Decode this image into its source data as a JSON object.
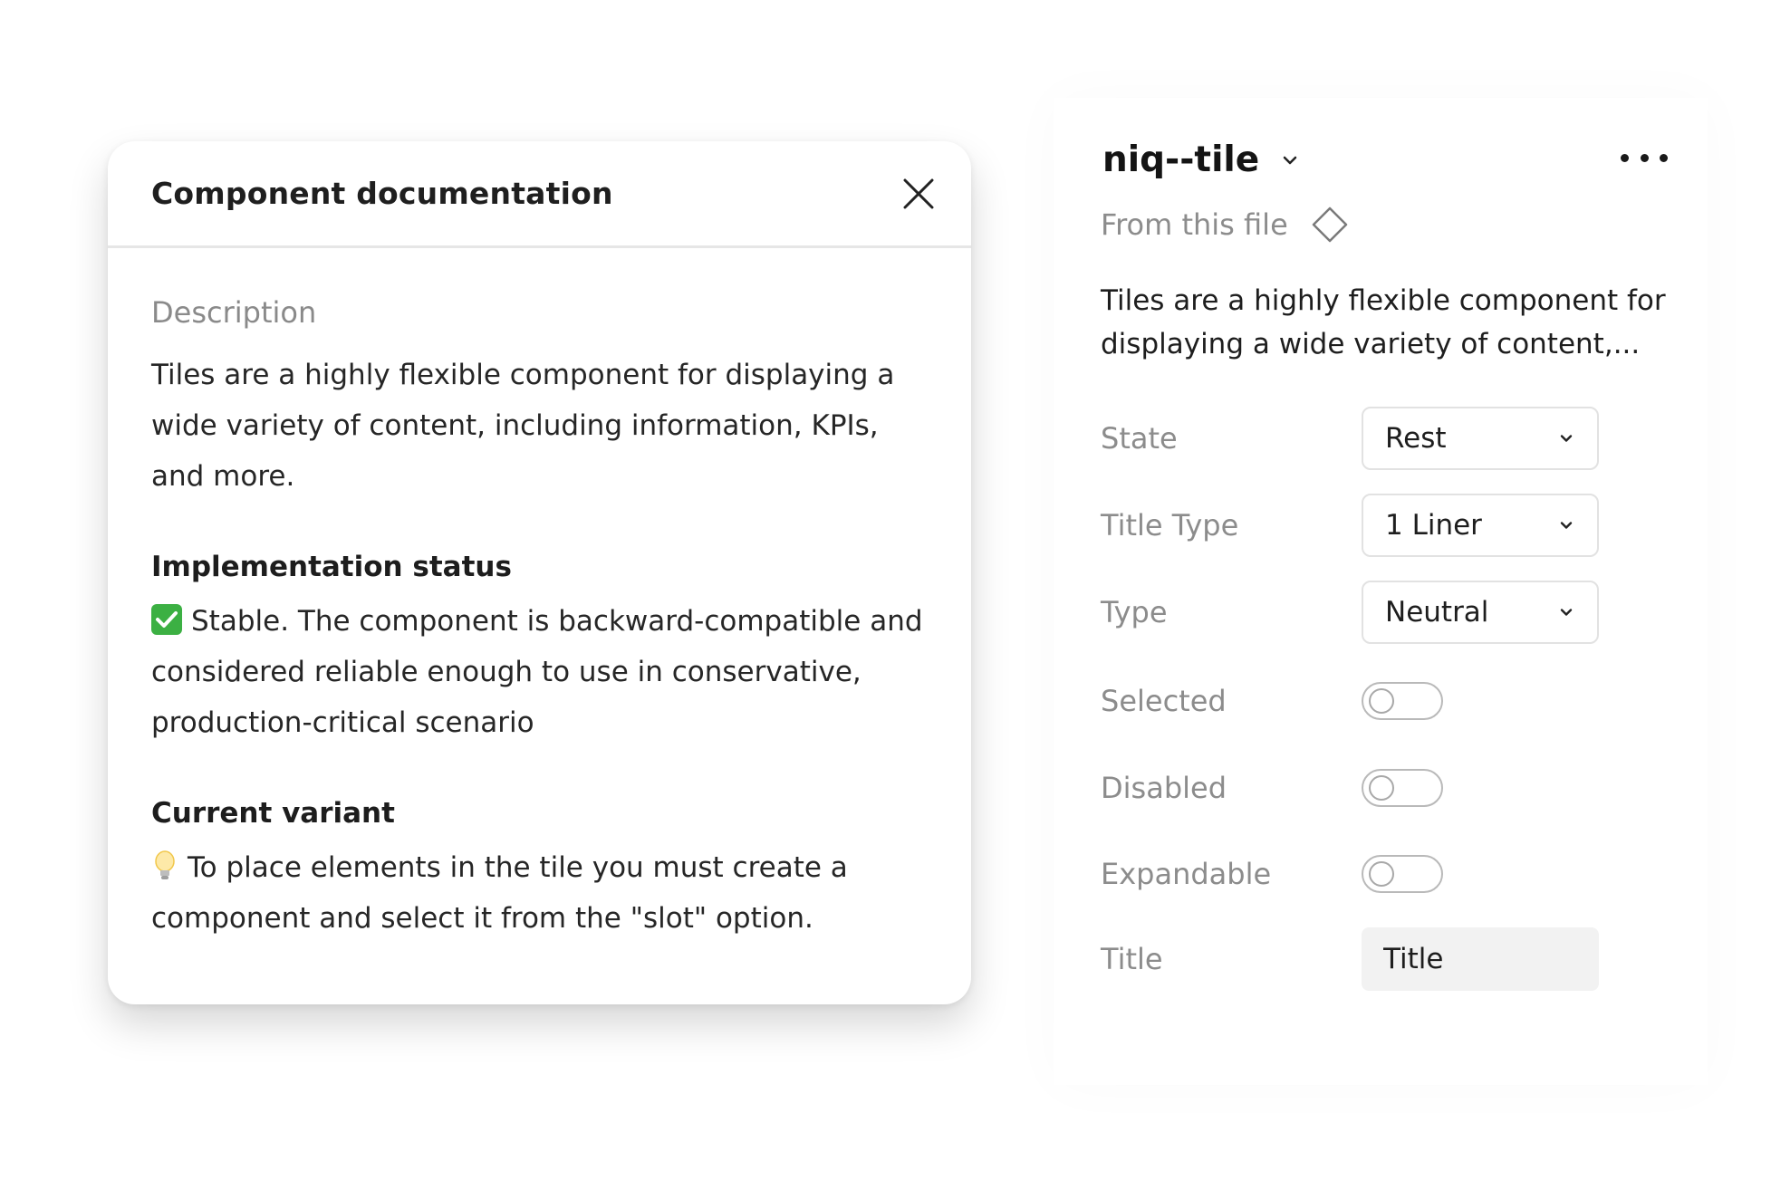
{
  "doc_popover": {
    "title": "Component documentation",
    "description_label": "Description",
    "description": "Tiles are a highly flexible component for displaying a wide variety of content, including information, KPIs, and more.",
    "implementation_heading": "Implementation status",
    "implementation_text": "Stable. The component is backward-compatible and considered reliable enough to use in conservative, production-critical scenario",
    "variant_heading": "Current variant",
    "variant_text": "To place elements in the tile you must create a component and select it from the \"slot\" option.",
    "icons": {
      "close": "close-icon",
      "status": "check-mark-emoji",
      "tip": "light-bulb-emoji"
    }
  },
  "panel": {
    "component_name": "niq--tile",
    "source": "From this file",
    "description": "Tiles are a highly flexible component for displaying a wide variety of content,...",
    "icons": {
      "name_dropdown": "chevron-down-icon",
      "more": "more-horizontal-icon",
      "source": "diamond-component-icon"
    },
    "props": {
      "state": {
        "label": "State",
        "value": "Rest"
      },
      "title_type": {
        "label": "Title Type",
        "value": "1 Liner"
      },
      "type": {
        "label": "Type",
        "value": "Neutral"
      },
      "selected": {
        "label": "Selected",
        "checked": false
      },
      "disabled": {
        "label": "Disabled",
        "checked": false
      },
      "expandable": {
        "label": "Expandable",
        "checked": false
      },
      "title": {
        "label": "Title",
        "value": "Title"
      }
    }
  },
  "colors": {
    "status_check": "#3cb043",
    "muted_text": "#8c8c8c",
    "input_bg": "#f2f2f2"
  }
}
